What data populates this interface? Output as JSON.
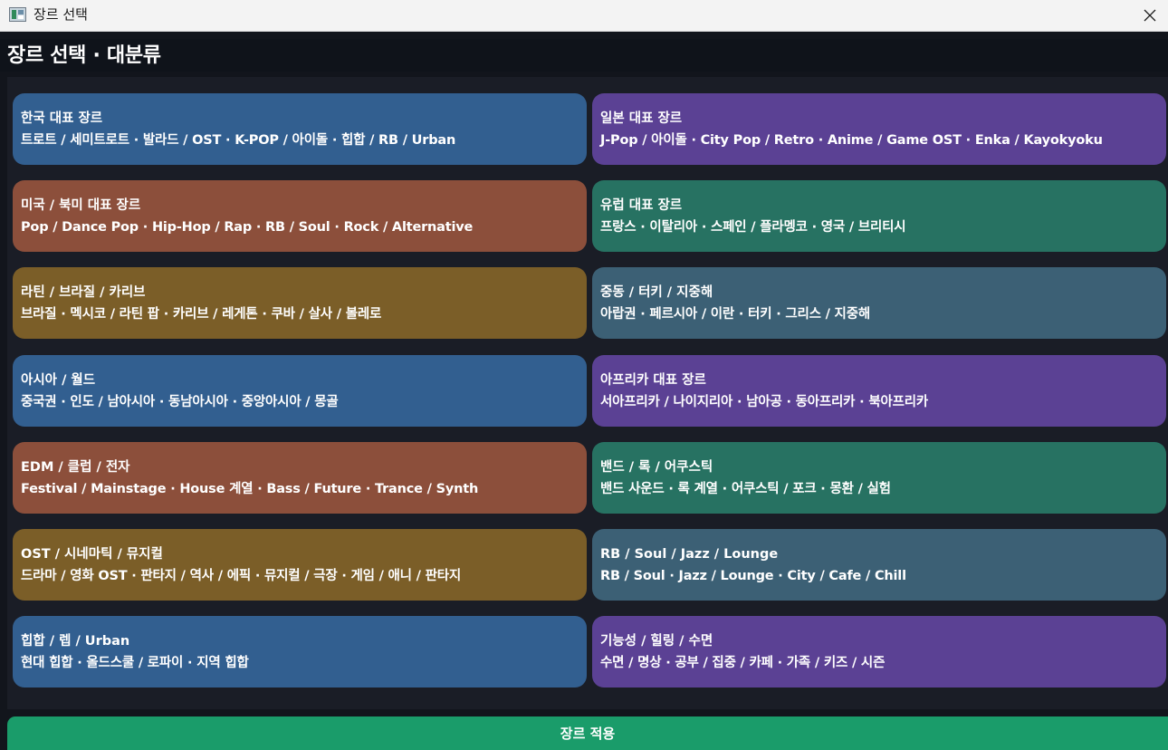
{
  "window": {
    "title": "장르 선택"
  },
  "header": {
    "title": "장르 선택 · 대분류"
  },
  "cards": [
    {
      "title": "한국 대표 장르",
      "subtitle": "트로트 / 세미트로트 · 발라드 / OST · K-POP / 아이돌 · 힙합 / RB / Urban",
      "color": "#325f90"
    },
    {
      "title": "일본 대표 장르",
      "subtitle": "J-Pop / 아이돌 · City Pop / Retro · Anime / Game OST · Enka / Kayokyoku",
      "color": "#5b4194"
    },
    {
      "title": "미국 / 북미 대표 장르",
      "subtitle": "Pop / Dance Pop · Hip-Hop / Rap · RB / Soul · Rock / Alternative",
      "color": "#8c4f3b"
    },
    {
      "title": "유럽 대표 장르",
      "subtitle": "프랑스 · 이탈리아 · 스페인 / 플라멩코 · 영국 / 브리티시",
      "color": "#277262"
    },
    {
      "title": "라틴 / 브라질 / 카리브",
      "subtitle": "브라질 · 멕시코 / 라틴 팝 · 카리브 / 레게톤 · 쿠바 / 살사 / 볼레로",
      "color": "#7b5e28"
    },
    {
      "title": "중동 / 터키 / 지중해",
      "subtitle": "아랍권 · 페르시아 / 이란 · 터키 · 그리스 / 지중해",
      "color": "#3c6075"
    },
    {
      "title": "아시아 / 월드",
      "subtitle": "중국권 · 인도 / 남아시아 · 동남아시아 · 중앙아시아 / 몽골",
      "color": "#325f90"
    },
    {
      "title": "아프리카 대표 장르",
      "subtitle": "서아프리카 / 나이지리아 · 남아공 · 동아프리카 · 북아프리카",
      "color": "#5b4194"
    },
    {
      "title": "EDM / 클럽 / 전자",
      "subtitle": "Festival / Mainstage · House 계열 · Bass / Future · Trance / Synth",
      "color": "#8c4f3b"
    },
    {
      "title": "밴드 / 록 / 어쿠스틱",
      "subtitle": "밴드 사운드 · 록 계열 · 어쿠스틱 / 포크 · 몽환 / 실험",
      "color": "#277262"
    },
    {
      "title": "OST / 시네마틱 / 뮤지컬",
      "subtitle": "드라마 / 영화 OST · 판타지 / 역사 / 에픽 · 뮤지컬 / 극장 · 게임 / 애니 / 판타지",
      "color": "#7b5e28"
    },
    {
      "title": "RB / Soul / Jazz / Lounge",
      "subtitle": "RB / Soul · Jazz / Lounge · City / Cafe / Chill",
      "color": "#3c6075"
    },
    {
      "title": "힙합 / 렙 / Urban",
      "subtitle": "현대 힙합 · 올드스쿨 / 로파이 · 지역 힙합",
      "color": "#325f90"
    },
    {
      "title": "기능성 / 힐링 / 수면",
      "subtitle": "수면 / 명상 · 공부 / 집중 / 카페 · 가족 / 키즈 / 시즌",
      "color": "#5b4194"
    }
  ],
  "footer": {
    "apply_label": "장르 적용"
  },
  "colors": {
    "apply": "#1a9c6a",
    "background": "#12151c",
    "panel": "#1a1d26"
  },
  "icons": {
    "app": "app-icon",
    "close": "close-icon"
  }
}
